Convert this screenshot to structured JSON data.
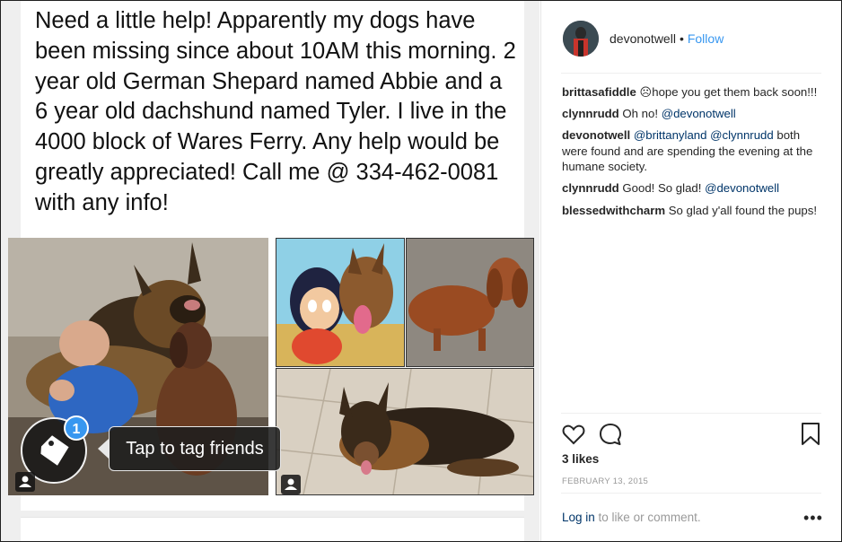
{
  "post": {
    "text": "Need a little help! Apparently my dogs have been missing since about 10AM this morning. 2 year old German Shepard named Abbie and a 6 year old dachshund named Tyler. I live in the 4000 block of Wares Ferry. Any help would be greatly appreciated! Call me @ 334-462-0081 with any info!",
    "tag_badge_count": "1",
    "tag_prompt": "Tap to tag friends"
  },
  "header": {
    "username": "devonotwell",
    "separator": "•",
    "follow_label": "Follow"
  },
  "comments": [
    {
      "user": "brittasafiddle",
      "text": "☹hope you get them back soon!!!"
    },
    {
      "user": "clynnrudd",
      "text": "Oh no! ",
      "mention": "@devonotwell"
    },
    {
      "user": "devonotwell",
      "mention1": "@brittanyland",
      "mention2": "@clynnrudd",
      "text": " both were found and are spending the evening at the humane society."
    },
    {
      "user": "clynnrudd",
      "text": "Good! So glad! ",
      "mention": "@devonotwell"
    },
    {
      "user": "blessedwithcharm",
      "text": "So glad y'all found the pups!"
    }
  ],
  "stats": {
    "likes": "3 likes",
    "date": "FEBRUARY 13, 2015"
  },
  "footer": {
    "login_link": "Log in",
    "login_rest": " to like or comment.",
    "more": "•••"
  },
  "colors": {
    "link_blue": "#3897f0",
    "mention_blue": "#003569",
    "text": "#262626",
    "muted": "#999999"
  }
}
